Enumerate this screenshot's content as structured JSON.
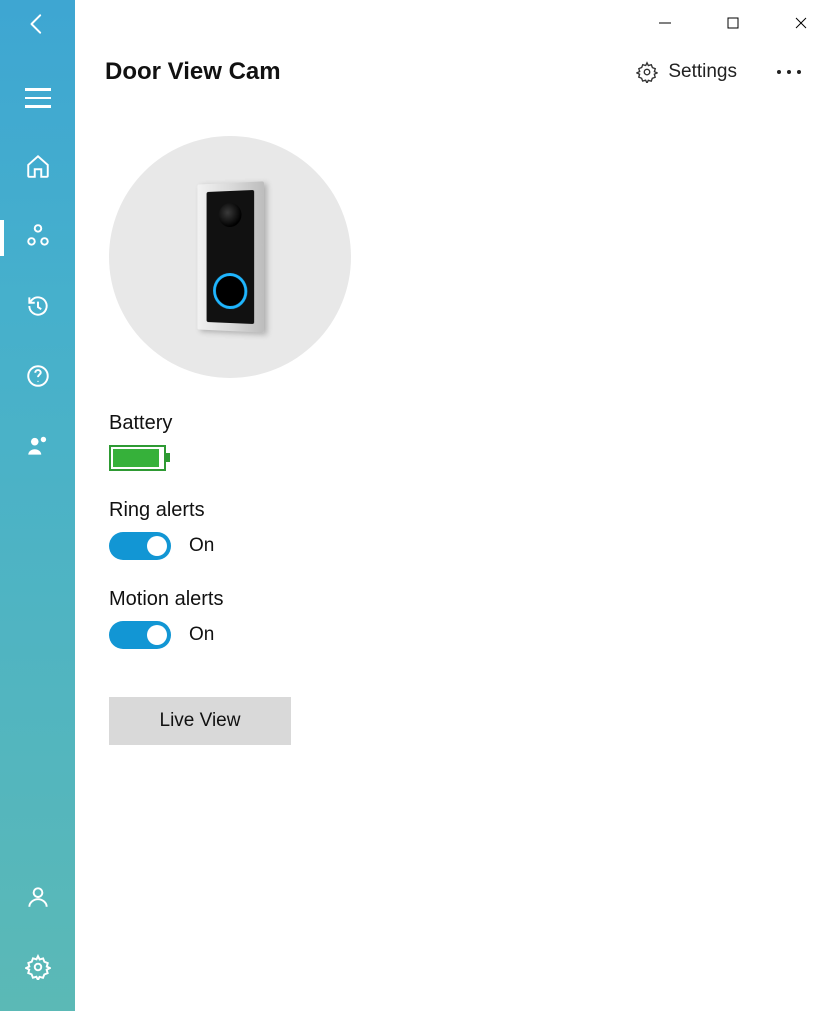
{
  "header": {
    "title": "Door View Cam",
    "settings_label": "Settings"
  },
  "sections": {
    "battery": {
      "label": "Battery"
    },
    "ring_alerts": {
      "label": "Ring alerts",
      "state": "On"
    },
    "motion_alerts": {
      "label": "Motion alerts",
      "state": "On"
    }
  },
  "actions": {
    "live_view": "Live View"
  }
}
